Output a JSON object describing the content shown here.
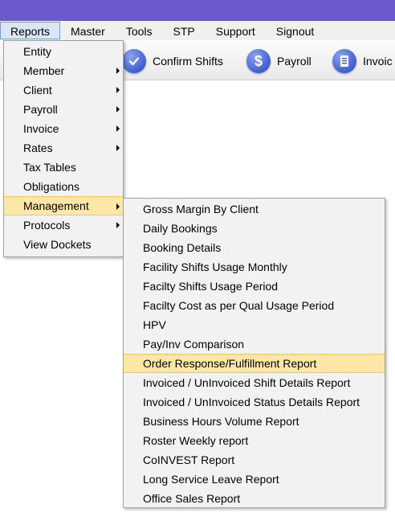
{
  "menubar": {
    "items": [
      "Reports",
      "Master",
      "Tools",
      "STP",
      "Support",
      "Signout"
    ]
  },
  "toolbar": {
    "confirm_shifts_label": "Confirm Shifts",
    "payroll_label": "Payroll",
    "invoice_label": "Invoic"
  },
  "reports_menu": {
    "items": [
      {
        "label": "Entity",
        "submenu": false
      },
      {
        "label": "Member",
        "submenu": true
      },
      {
        "label": "Client",
        "submenu": true
      },
      {
        "label": "Payroll",
        "submenu": true
      },
      {
        "label": "Invoice",
        "submenu": true
      },
      {
        "label": "Rates",
        "submenu": true
      },
      {
        "label": "Tax Tables",
        "submenu": false
      },
      {
        "label": "Obligations",
        "submenu": false
      },
      {
        "label": "Management",
        "submenu": true,
        "highlighted": true
      },
      {
        "label": "Protocols",
        "submenu": true
      },
      {
        "label": "View Dockets",
        "submenu": false
      }
    ]
  },
  "management_menu": {
    "items": [
      {
        "label": "Gross Margin By Client"
      },
      {
        "label": "Daily Bookings"
      },
      {
        "label": "Booking Details"
      },
      {
        "label": "Facility Shifts Usage Monthly"
      },
      {
        "label": "Facilty Shifts Usage Period"
      },
      {
        "label": "Facilty Cost as per Qual Usage Period"
      },
      {
        "label": "HPV"
      },
      {
        "label": "Pay/Inv Comparison"
      },
      {
        "label": "Order Response/Fulfillment Report",
        "highlighted": true
      },
      {
        "label": "Invoiced / UnInvoiced Shift Details Report"
      },
      {
        "label": "Invoiced / UnInvoiced Status Details Report"
      },
      {
        "label": "Business Hours Volume Report"
      },
      {
        "label": "Roster Weekly report"
      },
      {
        "label": "CoINVEST Report"
      },
      {
        "label": "Long Service Leave Report"
      },
      {
        "label": "Office Sales Report"
      }
    ]
  },
  "colors": {
    "titlebar": "#6a5acd",
    "highlight": "#fde7a7",
    "accent": "#3f5fd0"
  }
}
